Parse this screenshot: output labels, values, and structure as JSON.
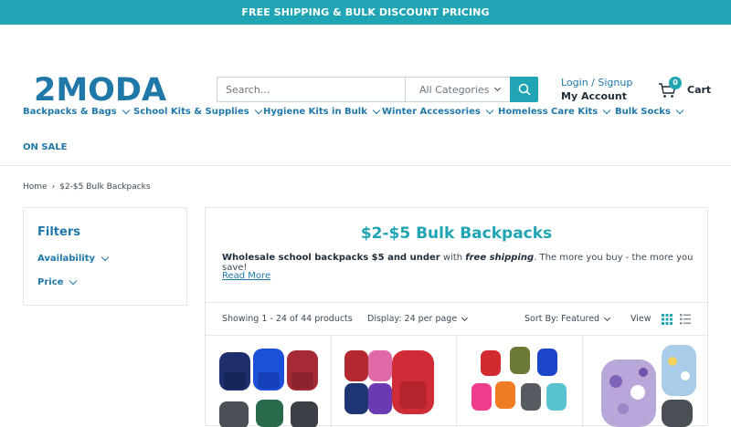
{
  "promo_bar": {
    "text": "FREE SHIPPING & BULK DISCOUNT PRICING"
  },
  "logo": {
    "text": "2MODA"
  },
  "search": {
    "placeholder": "Search...",
    "category": "All Categories"
  },
  "account": {
    "login": "Login / Signup",
    "my_account": "My Account"
  },
  "cart": {
    "count": "0",
    "label": "Cart"
  },
  "nav": [
    {
      "label": "Backpacks & Bags"
    },
    {
      "label": "School Kits & Supplies"
    },
    {
      "label": "Hygiene Kits in Bulk"
    },
    {
      "label": "Winter Accessories"
    },
    {
      "label": "Homeless Care Kits"
    },
    {
      "label": "Bulk Socks"
    },
    {
      "label": "ON SALE"
    }
  ],
  "breadcrumb": {
    "home": "Home",
    "separator": "›",
    "current": "$2-$5 Bulk Backpacks"
  },
  "filters": {
    "title": "Filters",
    "availability": "Availability",
    "price": "Price"
  },
  "category": {
    "title": "$2-$5 Bulk Backpacks",
    "desc_bold": "Wholesale school backpacks $5 and under",
    "desc_mid": " with ",
    "desc_italic": "free shipping",
    "desc_rest": ". The more you buy - the more you save!",
    "read_more": "Read More"
  },
  "toolbar": {
    "showing": "Showing 1 - 24 of 44 products",
    "display": "Display: 24 per page",
    "sort": "Sort By: Featured",
    "view": "View"
  },
  "colors": {
    "accent": "#1fa5b3",
    "link": "#1f78a8",
    "text": "#1e2d3a"
  },
  "products": [
    {
      "image": "backpacks-navy-blue-red-grey-green"
    },
    {
      "image": "backpacks-red-pink-navy-purple"
    },
    {
      "image": "backpacks-red-olive-blue-pink-orange-grey-teal"
    },
    {
      "image": "backpacks-floral-purple-light-blue"
    }
  ]
}
